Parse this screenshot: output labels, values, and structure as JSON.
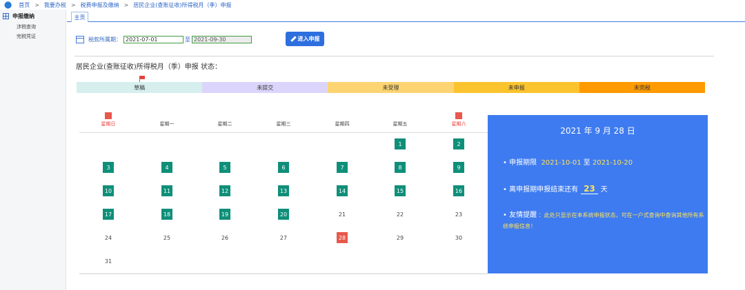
{
  "breadcrumb": [
    "首页",
    "我要办税",
    "税费申报及缴纳",
    "居民企业(查账征收)所得税月（季）申报"
  ],
  "breadcrumb_sep": ">",
  "sidebar": {
    "title": "申报缴纳",
    "items": [
      "涉税查询",
      "完税凭证"
    ]
  },
  "tabs": [
    "主页"
  ],
  "period": {
    "label": "税款所属期：",
    "start": "2021-07-01",
    "to": "至",
    "end": "2021-09-30"
  },
  "enter_button": "进入申报",
  "status_title": "居民企业(查账征收)所得税月（季）申报 状态：",
  "stages": [
    {
      "label": "草稿",
      "color": "#d6efee"
    },
    {
      "label": "未提交",
      "color": "#dcd5fb"
    },
    {
      "label": "未受理",
      "color": "#fdd472"
    },
    {
      "label": "未申报",
      "color": "#fbc42e"
    },
    {
      "label": "未完税",
      "color": "#ff9a00"
    }
  ],
  "weekdays": [
    "星期日",
    "星期一",
    "星期二",
    "星期三",
    "星期四",
    "星期五",
    "星期六"
  ],
  "calendar_weeks": [
    [
      "",
      "",
      "",
      "",
      "",
      "1",
      "2"
    ],
    [
      "3",
      "4",
      "5",
      "6",
      "7",
      "8",
      "9"
    ],
    [
      "10",
      "11",
      "12",
      "13",
      "14",
      "15",
      "16"
    ],
    [
      "17",
      "18",
      "19",
      "20",
      "21",
      "22",
      "23"
    ],
    [
      "24",
      "25",
      "26",
      "27",
      "28",
      "29",
      "30"
    ],
    [
      "31",
      "",
      "",
      "",
      "",
      "",
      ""
    ]
  ],
  "highlight_through_day": 20,
  "today_day": 28,
  "panel": {
    "date": "2021 年 9 月 28 日",
    "period_label": "• 申报期限",
    "period_start": "2021-10-01",
    "period_mid": "至",
    "period_end": "2021-10-20",
    "remain_pre": "• 离申报期申报结束还有",
    "remain_days": "23",
    "remain_post": "天",
    "tip_title": "• 友情提醒",
    "tip_text": "：此处只显示在本系统申报状态，可在一户式查询中查询其他所有系统申报信息！"
  },
  "colors": {
    "accent": "#2d6fde",
    "panel": "#3e7bf0",
    "day_green": "#0f8f79",
    "today": "#e8584c"
  }
}
